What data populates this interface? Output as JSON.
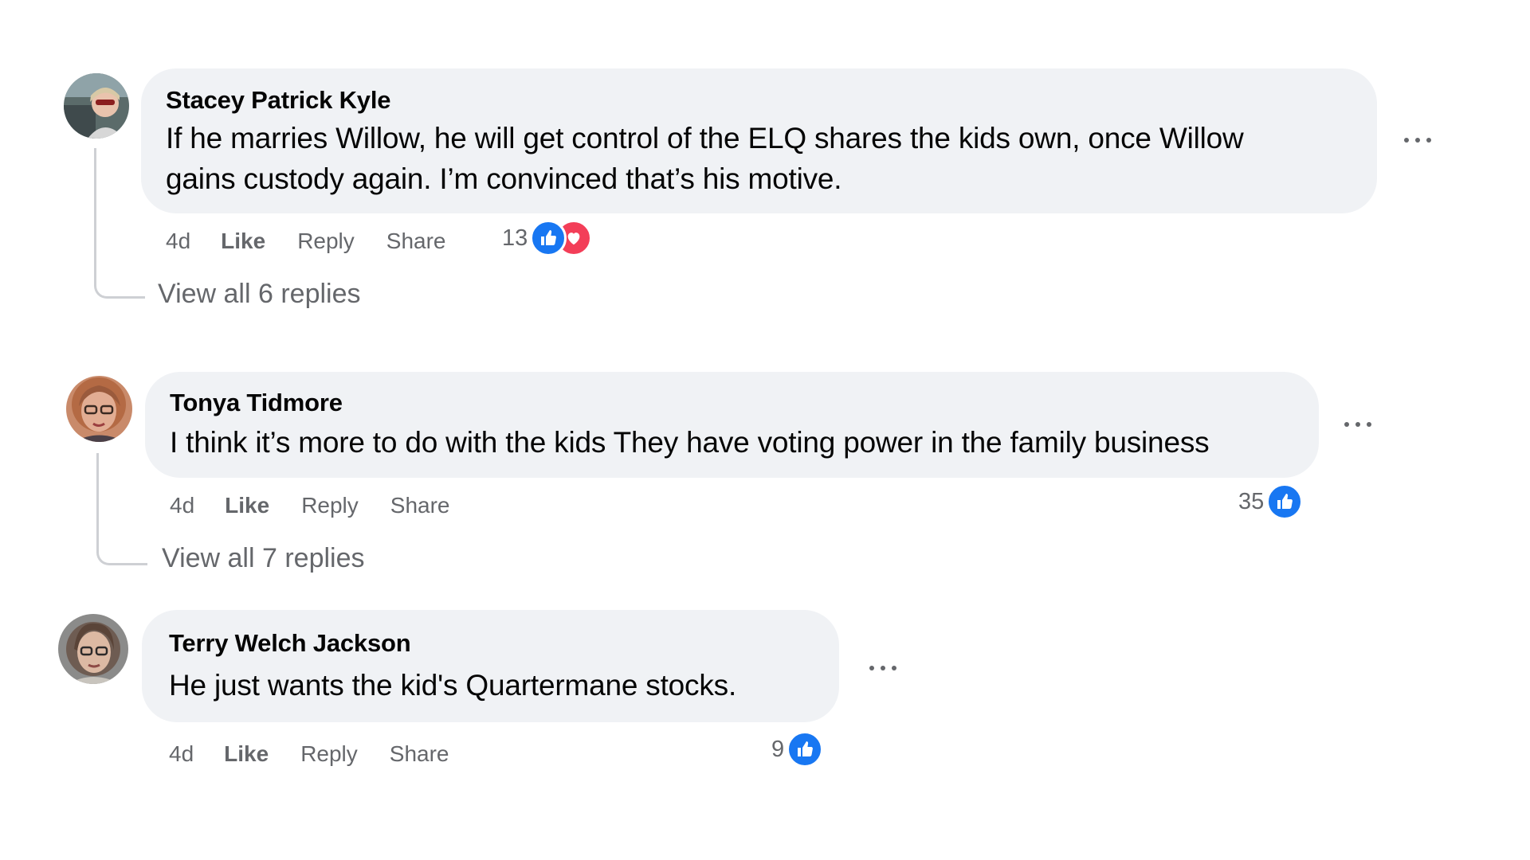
{
  "comments": [
    {
      "author": "Stacey Patrick Kyle",
      "text_line1": "If he marries Willow, he will get control of the ELQ shares the kids own, once Willow",
      "text_line2": "gains custody again. I’m convinced that’s his motive.",
      "time": "4d",
      "like_label": "Like",
      "reply_label": "Reply",
      "share_label": "Share",
      "reaction_count": "13",
      "reactions": [
        "like-icon",
        "love-icon"
      ],
      "view_replies": "View all 6 replies"
    },
    {
      "author": "Tonya Tidmore",
      "text": "I think it’s more to do with the kids They have voting power in the family business",
      "time": "4d",
      "like_label": "Like",
      "reply_label": "Reply",
      "share_label": "Share",
      "reaction_count": "35",
      "reactions": [
        "like-icon"
      ],
      "view_replies": "View all 7 replies"
    },
    {
      "author": "Terry Welch Jackson",
      "text": "He just wants the kid's Quartermane stocks.",
      "time": "4d",
      "like_label": "Like",
      "reply_label": "Reply",
      "share_label": "Share",
      "reaction_count": "9",
      "reactions": [
        "like-icon"
      ]
    }
  ],
  "colors": {
    "bubble": "#f0f2f5",
    "secondary_text": "#65676b",
    "like_blue": "#1877f2",
    "love_red": "#f33e58",
    "thread_line": "#ced0d4"
  }
}
